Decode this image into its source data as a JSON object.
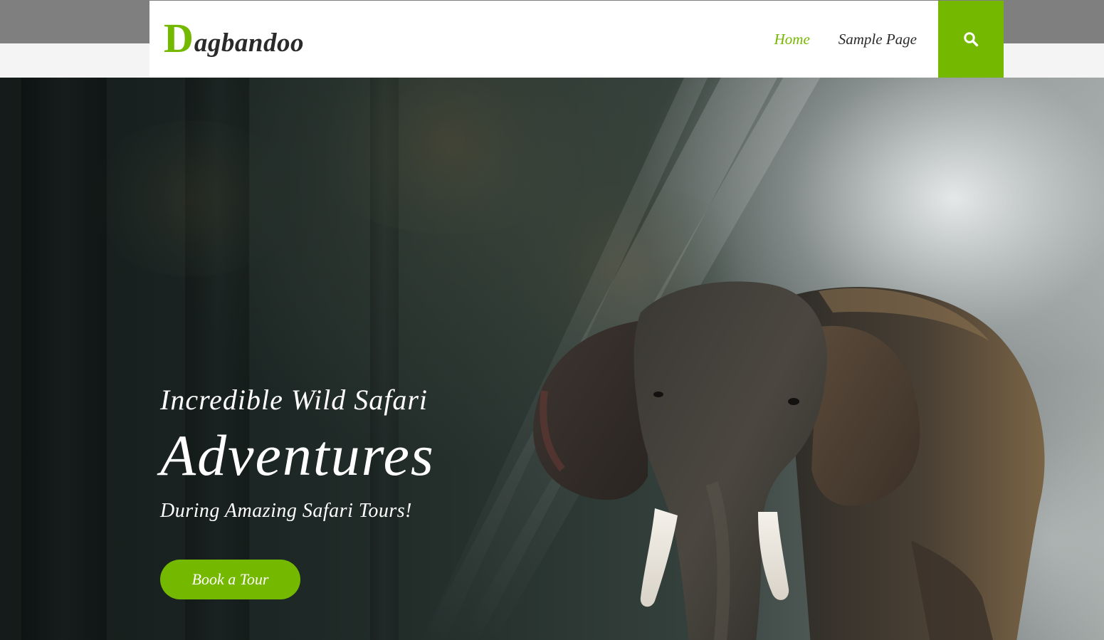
{
  "site": {
    "logo_initial": "D",
    "logo_rest": "agbandoo"
  },
  "nav": {
    "items": [
      {
        "label": "Home",
        "active": true
      },
      {
        "label": "Sample Page",
        "active": false
      }
    ],
    "search_icon": "search-icon"
  },
  "hero": {
    "subtitle": "Incredible Wild Safari",
    "title": "Adventures",
    "tagline": "During Amazing Safari Tours!",
    "cta_label": "Book a Tour",
    "background_image": "elephant-in-forest"
  },
  "colors": {
    "accent": "#75b800",
    "header_bg": "#ffffff",
    "top_band": "#7f7f7f",
    "text_dark": "#2a2a2a"
  }
}
